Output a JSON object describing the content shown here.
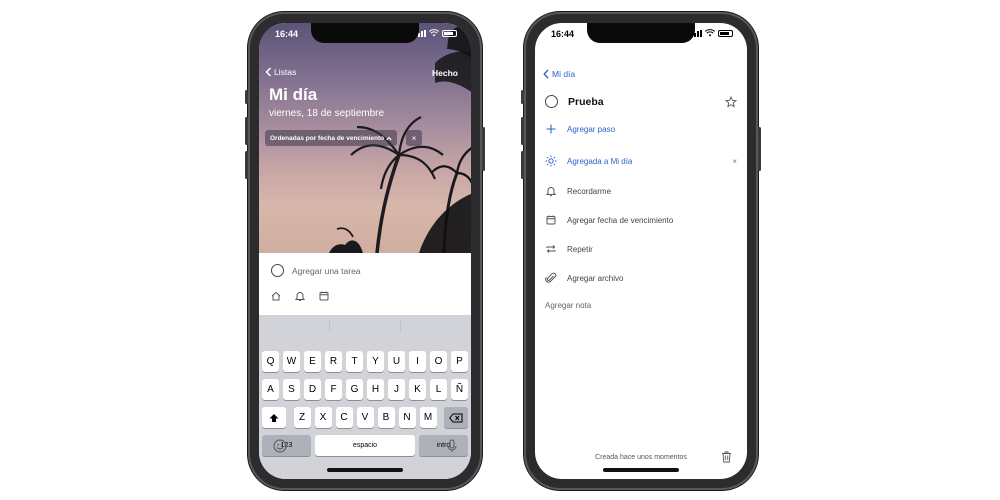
{
  "status": {
    "time": "16:44"
  },
  "left": {
    "back_label": "Listas",
    "done_label": "Hecho",
    "title": "Mi día",
    "subtitle": "viernes, 18 de septiembre",
    "sort_chip": "Ordenadas por fecha de vencimiento",
    "sort_clear": "×",
    "add_task_placeholder": "Agregar una tarea",
    "sheet_icons": [
      "my-day-icon",
      "bell-icon",
      "calendar-icon"
    ]
  },
  "keyboard": {
    "row1": [
      "Q",
      "W",
      "E",
      "R",
      "T",
      "Y",
      "U",
      "I",
      "O",
      "P"
    ],
    "row2": [
      "A",
      "S",
      "D",
      "F",
      "G",
      "H",
      "J",
      "K",
      "L",
      "Ñ"
    ],
    "row3": [
      "Z",
      "X",
      "C",
      "V",
      "B",
      "N",
      "M"
    ],
    "numbers_label": "123",
    "space_label": "espacio",
    "return_label": "intro"
  },
  "right": {
    "back_label": "Mi día",
    "task_title": "Prueba",
    "options": {
      "add_step": "Agregar paso",
      "added_my_day": "Agregada a Mi día",
      "remind": "Recordarme",
      "due_date": "Agregar fecha de vencimiento",
      "repeat": "Repetir",
      "attach": "Agregar archivo"
    },
    "remove_my_day": "×",
    "note_placeholder": "Agregar nota",
    "created_text": "Creada hace unos momentos"
  },
  "colors": {
    "accent": "#2b63c9"
  }
}
